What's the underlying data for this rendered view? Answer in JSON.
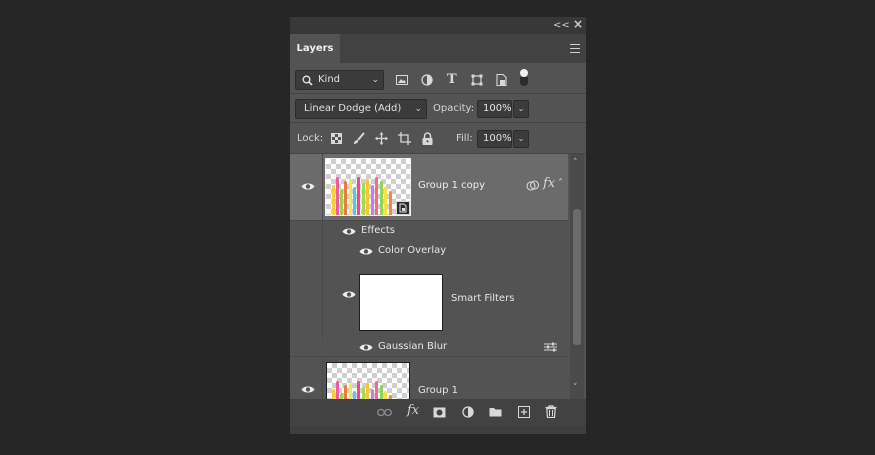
{
  "panel": {
    "tab_label": "Layers",
    "collapse_glyph": "<<",
    "close_glyph": "×"
  },
  "filter": {
    "kind_label": "Kind",
    "icons": [
      "image-filter-icon",
      "adjustment-filter-icon",
      "type-filter-icon",
      "shape-filter-icon",
      "smart-object-filter-icon",
      "filter-toggle"
    ]
  },
  "blend": {
    "mode": "Linear Dodge (Add)",
    "opacity_label": "Opacity:",
    "opacity_value": "100%"
  },
  "lock": {
    "label": "Lock:",
    "fill_label": "Fill:",
    "fill_value": "100%"
  },
  "layers": [
    {
      "name": "Group 1 copy",
      "selected": true,
      "effects_label": "Effects",
      "effects": [
        "Color Overlay"
      ],
      "smart_filters_label": "Smart Filters",
      "filters": [
        "Gaussian Blur"
      ]
    },
    {
      "name": "Group 1",
      "selected": false
    }
  ],
  "footer": {
    "icons": [
      "link-layers-icon",
      "fx-icon",
      "layer-mask-icon",
      "adjustment-layer-icon",
      "new-group-icon",
      "new-layer-icon",
      "delete-icon"
    ],
    "fx_text": "fx"
  },
  "colors": {
    "background": "#262626",
    "panel": "#535353",
    "selected_row": "#6b6b6b",
    "tab_bar": "#424242"
  }
}
